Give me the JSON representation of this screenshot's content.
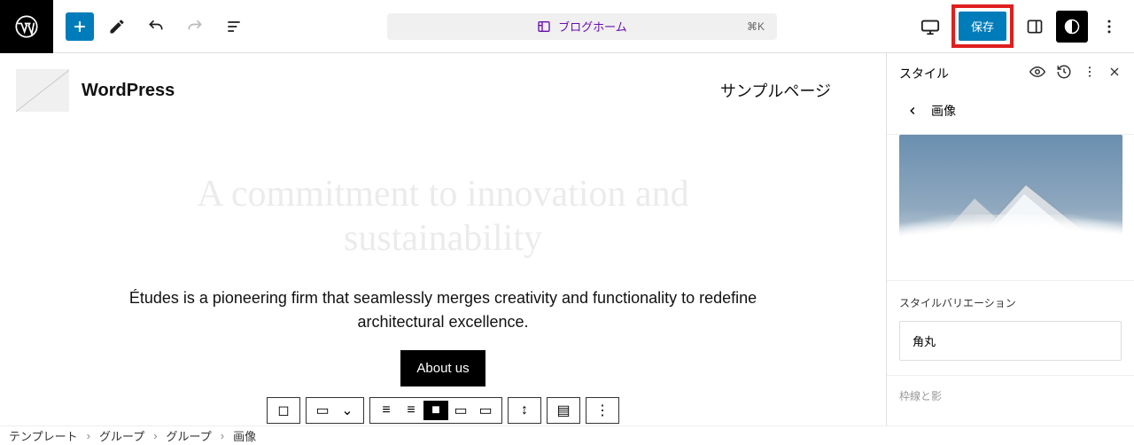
{
  "topbar": {
    "doc_title": "ブログホーム",
    "shortcut": "⌘K",
    "save_label": "保存"
  },
  "site": {
    "title": "WordPress",
    "nav_link": "サンプルページ"
  },
  "hero": {
    "heading": "A commitment to innovation and sustainability",
    "paragraph": "Études is a pioneering firm that seamlessly merges creativity and functionality to redefine architectural excellence.",
    "button": "About us"
  },
  "sidebar": {
    "title": "スタイル",
    "back_label": "画像",
    "variation_label": "スタイルバリエーション",
    "variation_option": "角丸",
    "section_peek": "枠線と影"
  },
  "breadcrumb": {
    "items": [
      "テンプレート",
      "グループ",
      "グループ",
      "画像"
    ]
  }
}
